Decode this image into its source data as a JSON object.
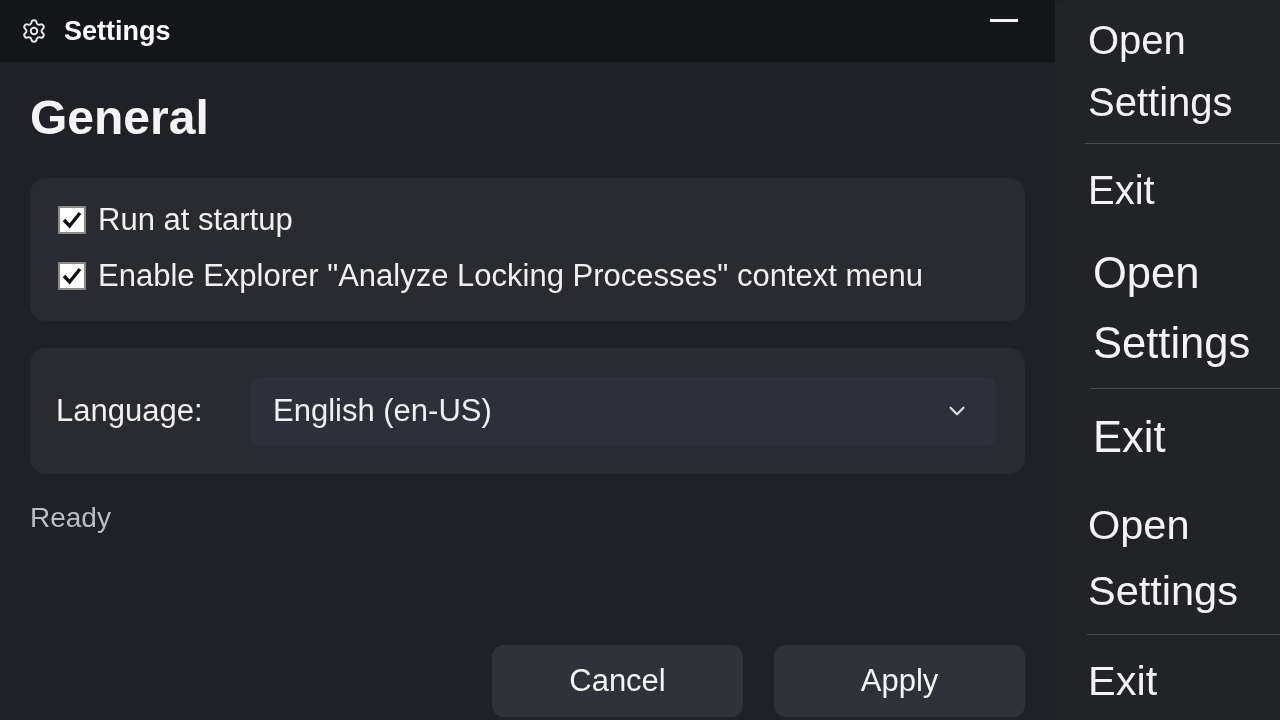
{
  "window": {
    "title": "Settings"
  },
  "section": {
    "title": "General"
  },
  "options": [
    {
      "label": "Run at startup",
      "checked": true
    },
    {
      "label": "Enable Explorer \"Analyze Locking Processes\" context menu",
      "checked": true
    }
  ],
  "language": {
    "label": "Language:",
    "value": "English (en-US)"
  },
  "status": "Ready",
  "buttons": [
    "Cancel",
    "Apply"
  ],
  "context_menus": [
    {
      "items": [
        "Open Settings",
        "Exit"
      ]
    },
    {
      "items": [
        "Open Settings",
        "Exit"
      ]
    },
    {
      "items": [
        "Open Settings",
        "Exit"
      ]
    }
  ]
}
